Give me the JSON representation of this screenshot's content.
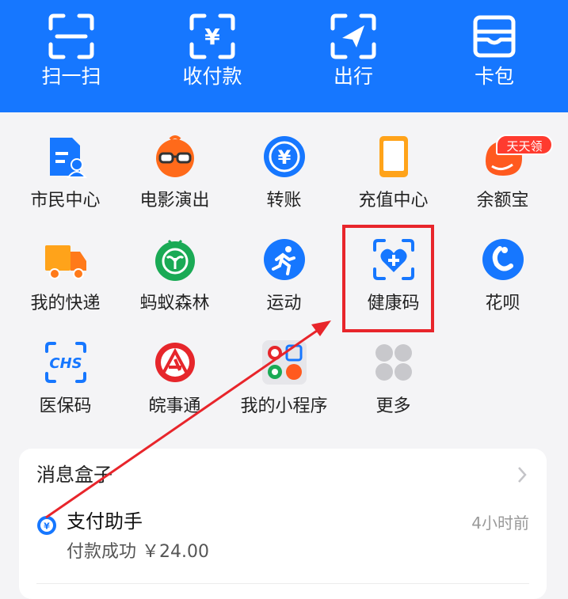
{
  "top_actions": [
    {
      "label": "扫一扫",
      "icon": "scan-icon"
    },
    {
      "label": "收付款",
      "icon": "payment-code-icon"
    },
    {
      "label": "出行",
      "icon": "travel-icon"
    },
    {
      "label": "卡包",
      "icon": "card-wallet-icon"
    }
  ],
  "grid_apps": [
    {
      "label": "市民中心",
      "icon": "citizen-center-icon"
    },
    {
      "label": "电影演出",
      "icon": "movie-icon"
    },
    {
      "label": "转账",
      "icon": "transfer-icon"
    },
    {
      "label": "充值中心",
      "icon": "recharge-icon"
    },
    {
      "label": "余额宝",
      "icon": "yuebao-icon",
      "badge": "天天领"
    },
    {
      "label": "我的快递",
      "icon": "express-icon"
    },
    {
      "label": "蚂蚁森林",
      "icon": "ant-forest-icon"
    },
    {
      "label": "运动",
      "icon": "sport-icon"
    },
    {
      "label": "健康码",
      "icon": "health-code-icon"
    },
    {
      "label": "花呗",
      "icon": "huabei-icon"
    },
    {
      "label": "医保码",
      "icon": "medical-insurance-icon"
    },
    {
      "label": "皖事通",
      "icon": "wanshitong-icon"
    },
    {
      "label": "我的小程序",
      "icon": "mini-programs-icon"
    },
    {
      "label": "更多",
      "icon": "more-icon"
    }
  ],
  "message_box": {
    "title": "消息盒子",
    "item": {
      "sender": "支付助手",
      "time": "4小时前",
      "content": "付款成功 ￥24.00"
    }
  },
  "colors": {
    "primary": "#1677ff",
    "highlight": "#e8252b",
    "orange": "#ff6a1a"
  }
}
